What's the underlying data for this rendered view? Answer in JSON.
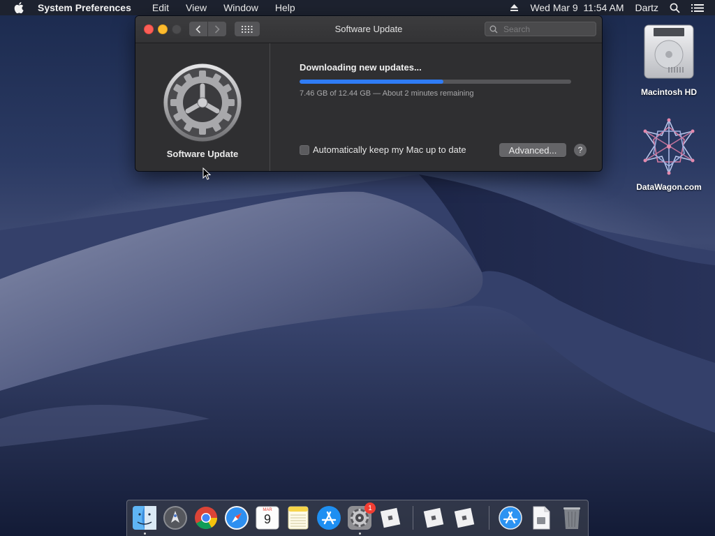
{
  "menubar": {
    "app_name": "System Preferences",
    "items": [
      "Edit",
      "View",
      "Window",
      "Help"
    ],
    "datetime": "Wed Mar 9  11:54 AM",
    "user": "Dartz"
  },
  "window": {
    "title": "Software Update",
    "search_placeholder": "Search",
    "pane_label": "Software Update",
    "status_title": "Downloading new updates...",
    "progress_fraction": 0.53,
    "progress_text": "7.46 GB of 12.44 GB — About 2 minutes remaining",
    "auto_update_label": "Automatically keep my Mac up to date",
    "advanced_label": "Advanced...",
    "help_label": "?"
  },
  "desktop": {
    "icons": [
      {
        "label": "Macintosh HD",
        "icon": "hard-drive-icon"
      },
      {
        "label": "DataWagon.com",
        "icon": "network-graph-icon"
      }
    ]
  },
  "dock": {
    "calendar_month": "MAR",
    "calendar_day": "9",
    "system_prefs_badge": "1",
    "items": [
      "finder-icon",
      "launchpad-icon",
      "chrome-icon",
      "safari-icon",
      "calendar-icon",
      "notes-icon",
      "app-store-icon",
      "system-preferences-icon",
      "roblox-icon",
      "roblox-studio-icon",
      "roblox-player-icon",
      "app-store-download-icon",
      "document-icon",
      "trash-icon"
    ]
  },
  "colors": {
    "accent": "#2f7cf6",
    "close": "#fc5f57",
    "minimize": "#fdbb2e"
  }
}
